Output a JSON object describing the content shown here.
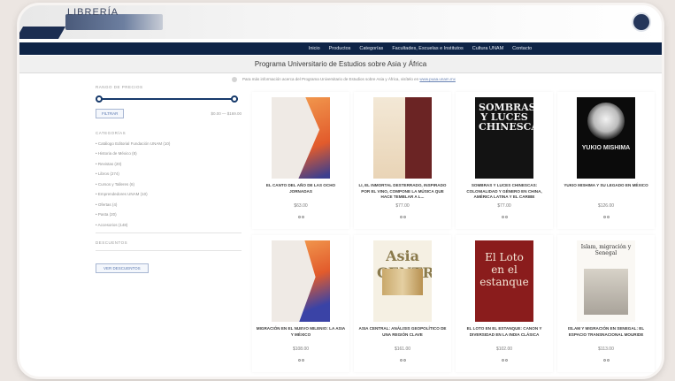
{
  "banner": {
    "logo_text": "LIBRERÍA"
  },
  "nav": {
    "items": [
      "Inicio",
      "Productos",
      "Categorías",
      "Facultades, Escuelas e Institutos",
      "Cultura UNAM",
      "Contacto"
    ]
  },
  "page": {
    "subtitle": "Programa Universitario de Estudios sobre Asia y África",
    "notice_text": "Para más información acerca del Programa Universitario de Estudios sobre Asia y África, visítelo en",
    "notice_link": "www.puaa.unam.mx"
  },
  "sidebar": {
    "price_heading": "RANGO DE PRECIOS",
    "price_slider": {
      "min_fraction": 0.0,
      "max_fraction": 1.0
    },
    "filter_label": "FILTRAR",
    "price_range": "$0.00 — $169.00",
    "categories_heading": "CATEGORÍAS",
    "categories": [
      "Catálogo Editorial Fundación UNAM (10)",
      "Historia de México (8)",
      "Revistas (20)",
      "Libros (274)",
      "Cursos y Talleres (6)",
      "Emprendedores UNAM (10)",
      "Ofertas (4)",
      "Pasta (20)",
      "Accesorios (148)"
    ],
    "discounts_heading": "DESCUENTOS",
    "discounts_button": "VER DESCUENTOS"
  },
  "products": [
    {
      "title": "EL CANTO DEL AÑO DE LAS OCHO JORNADAS",
      "price": "$63.00",
      "cover_text": ""
    },
    {
      "title": "LI, EL INMORTAL DESTERRADO, INSPIRADO POR EL VINO, COMPONE LA MÚSICA QUE HACE TEMBLAR A L...",
      "price": "$77.00",
      "cover_text": ""
    },
    {
      "title": "SOMBRAS Y LUCES CHINESCAS: COLONIALIDAD Y GÉNERO EN CHINA, AMÉRICA LATINA Y EL CARIBE",
      "price": "$77.00",
      "cover_text": "SOMBRAS Y LUCES CHINESCAS"
    },
    {
      "title": "YUKIO MISHIMA Y SU LEGADO EN MÉXICO",
      "price": "$126.00",
      "cover_text": "YUKIO MISHIMA"
    },
    {
      "title": "MIGRACIÓN EN EL NUEVO MILENIO: LA ASIA Y MÉXICO",
      "price": "$108.00",
      "cover_text": ""
    },
    {
      "title": "ASIA CENTRAL: ANÁLISIS GEOPOLÍTICO DE UNA REGIÓN CLAVE",
      "price": "$161.00",
      "cover_text": "Asia CENTRAL"
    },
    {
      "title": "EL LOTO EN EL ESTANQUE: CANON Y DIVERSIDAD EN LA INDIA CLÁSICA",
      "price": "$102.00",
      "cover_text": "El Loto en el estanque"
    },
    {
      "title": "ISLAM Y MIGRACIÓN EN SENEGAL: EL ESPACIO TRANSNACIONAL MOURIDE",
      "price": "$113.00",
      "cover_text": "Islam, migración y Senegal"
    }
  ],
  "colors": {
    "nav_bg": "#0e2447",
    "accent": "#5b79b0",
    "slider": "#173a6b"
  }
}
